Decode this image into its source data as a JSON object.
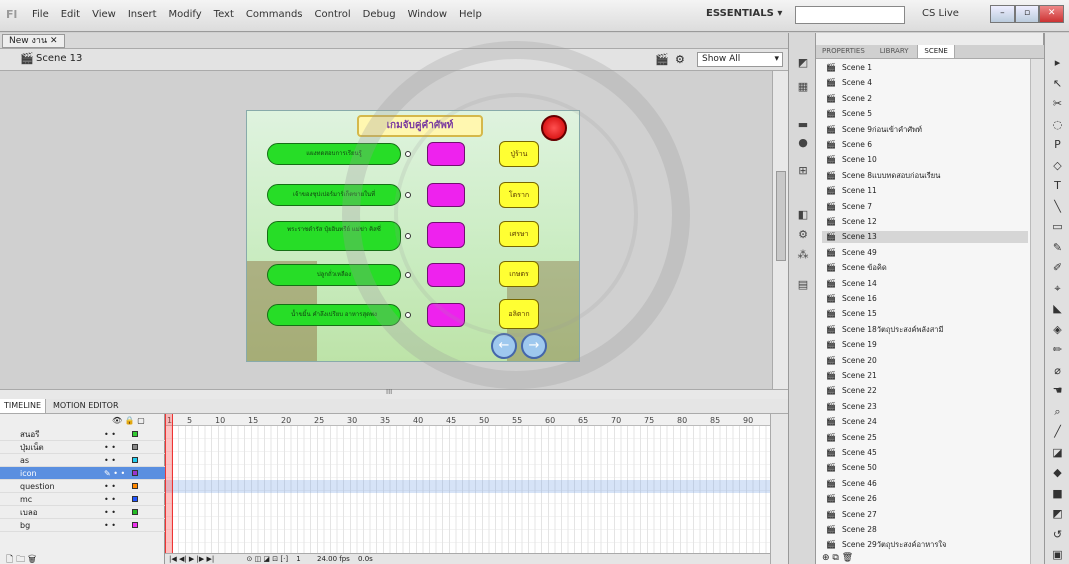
{
  "menubar": {
    "logo": "Fl",
    "menus": [
      "File",
      "Edit",
      "View",
      "Insert",
      "Modify",
      "Text",
      "Commands",
      "Control",
      "Debug",
      "Window",
      "Help"
    ],
    "workspace": "ESSENTIALS ▾",
    "search_placeholder": "",
    "cslive": "CS Live",
    "window_buttons": [
      "–",
      "▫",
      "✕"
    ]
  },
  "document": {
    "tab_label": "New งาน",
    "tab_close": "✕",
    "scene_label": "Scene 13",
    "zoom": "Show All",
    "hscroll_marker": "III"
  },
  "stage": {
    "title": "เกมจับคู่คำศัพท์",
    "rows": [
      {
        "green": "แผงทดสอบการเรียนรู้",
        "yellow": "ปู่ร้าน"
      },
      {
        "green": "เจ้าของซุปเปอร์มาร์เก็ตขายในที่",
        "yellow": "โตราก"
      },
      {
        "green": "พระราชดำรัส ปุ๋ยอินทรีย์ แม่ข่า คิสซี่",
        "yellow": "เศรษา"
      },
      {
        "green": "ปลูกถั่วเหลือง",
        "yellow": "เกษตร"
      },
      {
        "green": "น้ำขมิ้น คำลึงเปรียบ อาหารสุดพง",
        "yellow": "อลิตาก"
      }
    ],
    "back_arrow": "←",
    "forward_arrow": "→"
  },
  "timeline": {
    "tabs": [
      "TIMELINE",
      "MOTION EDITOR"
    ],
    "ruler": [
      "1",
      "5",
      "10",
      "15",
      "20",
      "25",
      "30",
      "35",
      "40",
      "45",
      "50",
      "55",
      "60",
      "65",
      "70",
      "75",
      "80",
      "85",
      "90"
    ],
    "layers": [
      {
        "name": "สนอรี",
        "color": "#33cc33"
      },
      {
        "name": "ปุ่มเน็ต",
        "color": "#888888"
      },
      {
        "name": "as",
        "color": "#22ccee"
      },
      {
        "name": "icon",
        "color": "#9933cc",
        "selected": true
      },
      {
        "name": "question",
        "color": "#ff8800"
      },
      {
        "name": "mc",
        "color": "#2255ff"
      },
      {
        "name": "เบลอ",
        "color": "#22bb22"
      },
      {
        "name": "bg",
        "color": "#ee33ee"
      }
    ],
    "status_frame": "1",
    "status_fps": "24.00 fps",
    "status_time": "0.0s"
  },
  "panel": {
    "tabs": [
      "PROPERTIES",
      "LIBRARY",
      "SCENE"
    ],
    "active_tab": "SCENE",
    "scenes": [
      "Scene 1",
      "Scene 4",
      "Scene 2",
      "Scene 5",
      "Scene 9ก่อนเข้าคำศัพท์",
      "Scene 6",
      "Scene 10",
      "Scene 8แบบทดสอบก่อนเรียน",
      "Scene 11",
      "Scene 7",
      "Scene 12",
      "Scene 13",
      "Scene 49",
      "Scene ข้อคิด",
      "Scene 14",
      "Scene 16",
      "Scene 15",
      "Scene 18วัตถุประสงค์พลังสามี",
      "Scene 19",
      "Scene 20",
      "Scene 21",
      "Scene 22",
      "Scene 23",
      "Scene 24",
      "Scene 25",
      "Scene 45",
      "Scene 50",
      "Scene 46",
      "Scene 26",
      "Scene 27",
      "Scene 28",
      "Scene 29วัตถุประสงค์อาหารใจ"
    ],
    "selected_scene": "Scene 13"
  },
  "toolstrip_icons": [
    "swatch-icon",
    "grid-icon",
    "align-icon",
    "info-icon",
    "transform-icon",
    "code-icon",
    "components-icon",
    "motion-icon",
    "movie-explorer-icon"
  ],
  "tools": [
    "▸",
    "↖",
    "✂",
    "◌",
    "P",
    "◇",
    "T",
    "╲",
    "▭",
    "✎",
    "✐",
    "⌖",
    "◣",
    "◈",
    "✏",
    "⌀",
    "☚",
    "⌕",
    "╱",
    "◪",
    "◆",
    "■",
    "◩",
    "↺",
    "▣"
  ],
  "colors": {
    "accent": "#5a8fe0",
    "green_button": "#27dd27",
    "magenta_box": "#ee22ee",
    "yellow_button": "#ffff33"
  }
}
